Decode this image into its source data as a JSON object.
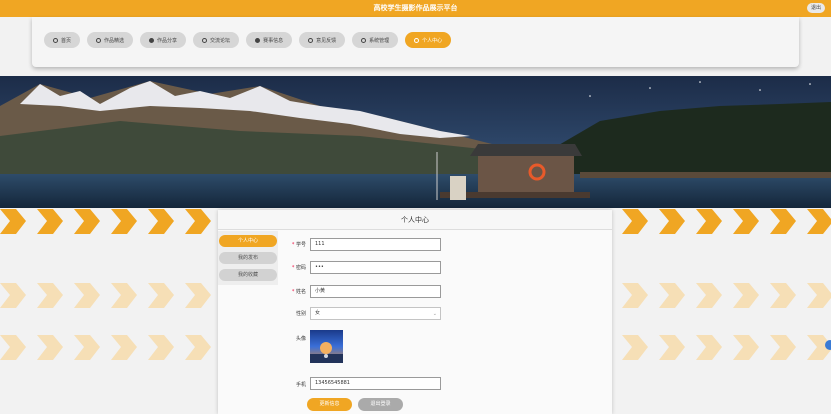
{
  "header": {
    "title": "高校学生摄影作品展示平台",
    "logout": "退出",
    "bar_color": "#f0a623"
  },
  "nav": {
    "items": [
      {
        "label": "首页",
        "icon": "home-icon"
      },
      {
        "label": "作品精选",
        "icon": "picture-icon"
      },
      {
        "label": "作品分享",
        "icon": "share-icon"
      },
      {
        "label": "交流论坛",
        "icon": "forum-icon"
      },
      {
        "label": "赛事信息",
        "icon": "trophy-icon"
      },
      {
        "label": "意见反馈",
        "icon": "feedback-icon"
      },
      {
        "label": "系统管理",
        "icon": "settings-icon"
      },
      {
        "label": "个人中心",
        "icon": "user-icon",
        "active": true
      }
    ]
  },
  "panel": {
    "title": "个人中心",
    "side": [
      "个人中心",
      "我的发布",
      "我的收藏"
    ],
    "form": {
      "student_id_label": "学号",
      "student_id_value": "111",
      "password_label": "密码",
      "password_value": "•••",
      "name_label": "姓名",
      "name_value": "小黄",
      "gender_label": "性别",
      "gender_value": "女",
      "avatar_label": "头像",
      "phone_label": "手机",
      "phone_value": "13456545881"
    },
    "save_button": "更新信息",
    "exit_button": "退出登录"
  },
  "accent_color": "#f0a623"
}
